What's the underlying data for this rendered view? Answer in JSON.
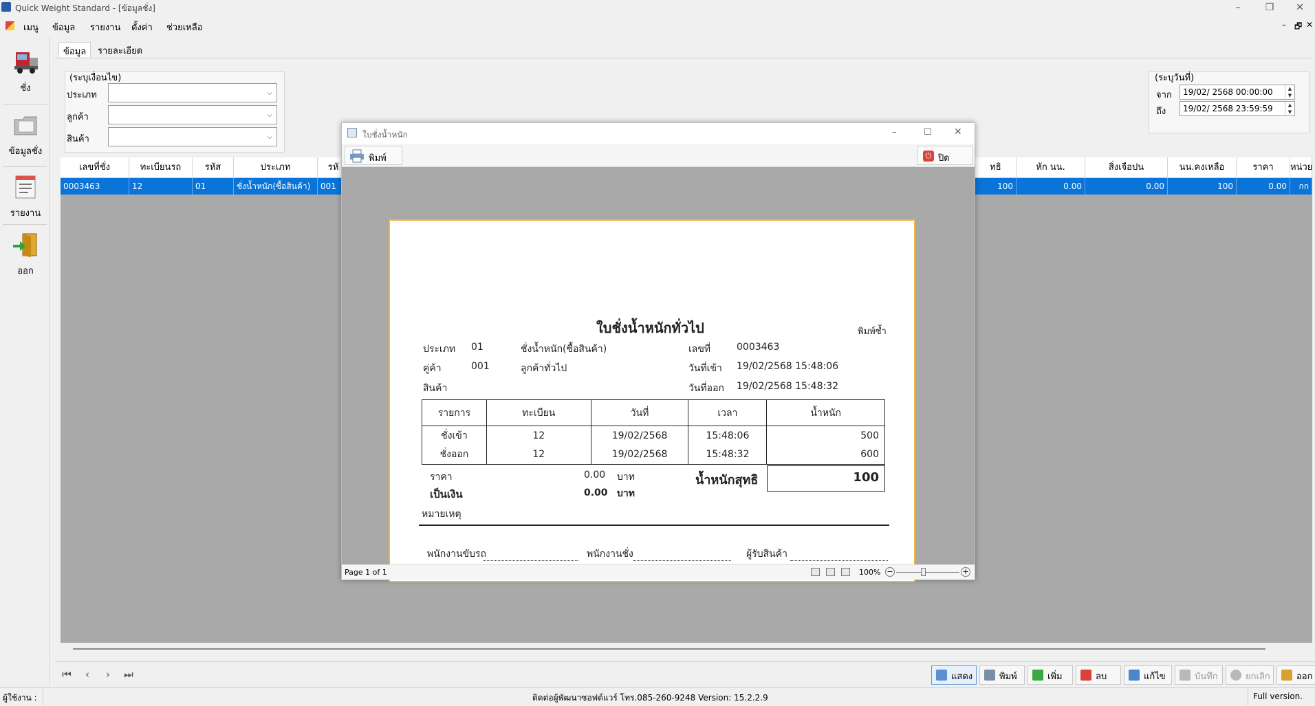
{
  "window": {
    "title": "Quick Weight Standard - [ข้อมูลชั่ง]"
  },
  "menu": [
    "เมนู",
    "ข้อมูล",
    "รายงาน",
    "ตั้งค่า",
    "ช่วยเหลือ"
  ],
  "sidebar": {
    "items": [
      {
        "label": "ชั่ง",
        "icon": "truck-icon"
      },
      {
        "label": "ข้อมูลชั่ง",
        "icon": "folder-icon"
      },
      {
        "label": "รายงาน",
        "icon": "report-icon"
      },
      {
        "label": "ออก",
        "icon": "exit-door-icon"
      }
    ]
  },
  "tabs": [
    "ข้อมูล",
    "รายละเอียด"
  ],
  "filter": {
    "title": "(ระบุเงื่อนไข)",
    "fields": [
      {
        "label": "ประเภท",
        "value": ""
      },
      {
        "label": "ลูกค้า",
        "value": ""
      },
      {
        "label": "สินค้า",
        "value": ""
      }
    ]
  },
  "date_range": {
    "title": "(ระบุวันที่)",
    "from_label": "จาก",
    "from_value": "19/02/ 2568  00:00:00",
    "to_label": "ถึง",
    "to_value": "19/02/ 2568  23:59:59"
  },
  "grid": {
    "columns": [
      "เลขที่ชั่ง",
      "ทะเบียนรถ",
      "รหัส",
      "ประเภท",
      "รหั",
      "ทธิ",
      "หัก นน.",
      "สิ่งเจือปน",
      "นน.คงเหลือ",
      "ราคา",
      "หน่วย"
    ],
    "row": [
      "0003463",
      "12",
      "01",
      "ชั่งน้ำหนัก(ซื้อสินค้า)",
      "001",
      "100",
      "0.00",
      "0.00",
      "100",
      "0.00",
      "กก"
    ]
  },
  "bottom": {
    "nav": [
      "⏮",
      "‹",
      "›",
      "⏭"
    ],
    "actions": [
      {
        "label": "แสดง",
        "icon": "show-icon",
        "state": "selected"
      },
      {
        "label": "พิมพ์",
        "icon": "printer-icon",
        "state": "normal"
      },
      {
        "label": "เพิ่ม",
        "icon": "add-icon",
        "state": "normal"
      },
      {
        "label": "ลบ",
        "icon": "delete-icon",
        "state": "normal"
      },
      {
        "label": "แก้ไข",
        "icon": "edit-icon",
        "state": "normal"
      },
      {
        "label": "บันทึก",
        "icon": "save-icon",
        "state": "disabled"
      },
      {
        "label": "ยกเลิก",
        "icon": "cancel-icon",
        "state": "disabled"
      },
      {
        "label": "ออก",
        "icon": "exit-icon",
        "state": "normal"
      }
    ]
  },
  "status": {
    "user_label": "ผู้ใช้งาน :",
    "contact": "ติดต่อผู้พัฒนาซอฟต์แวร์ โทร.085-260-9248 Version: 15.2.2.9",
    "license": "Full version."
  },
  "dialog": {
    "title": "ใบชั่งน้ำหนัก",
    "print_label": "พิมพ์",
    "close_label": "ปิด",
    "page_label": "Page 1 of 1",
    "zoom": "100%"
  },
  "receipt": {
    "title": "ใบชั่งน้ำหนักทั่วไป",
    "reprint": "พิมพ์ซ้ำ",
    "type_label": "ประเภท",
    "type_code": "01",
    "type_name": "ชั่งน้ำหนัก(ซื้อสินค้า)",
    "customer_label": "คู่ค้า",
    "customer_code": "001",
    "customer_name": "ลูกค้าทั่วไป",
    "product_label": "สินค้า",
    "no_label": "เลขที่",
    "no_value": "0003463",
    "in_label": "วันที่เข้า",
    "in_value": "19/02/2568 15:48:06",
    "out_label": "วันที่ออก",
    "out_value": "19/02/2568 15:48:32",
    "table_headers": [
      "รายการ",
      "ทะเบียน",
      "วันที่",
      "เวลา",
      "น้ำหนัก"
    ],
    "rows": [
      [
        "ชั่งเข้า",
        "12",
        "19/02/2568",
        "15:48:06",
        "500"
      ],
      [
        "ชั่งออก",
        "12",
        "19/02/2568",
        "15:48:32",
        "600"
      ]
    ],
    "price_label": "ราคา",
    "price_value": "0.00",
    "baht": "บาท",
    "amount_label": "เป็นเงิน",
    "amount_value": "0.00",
    "net_label": "น้ำหนักสุทธิ",
    "net_value": "100",
    "note_label": "หมายเหตุ",
    "sign_driver": "พนักงานขับรถ",
    "sign_weigher": "พนักงานชั่ง",
    "sign_receiver": "ผู้รับสินค้า"
  }
}
